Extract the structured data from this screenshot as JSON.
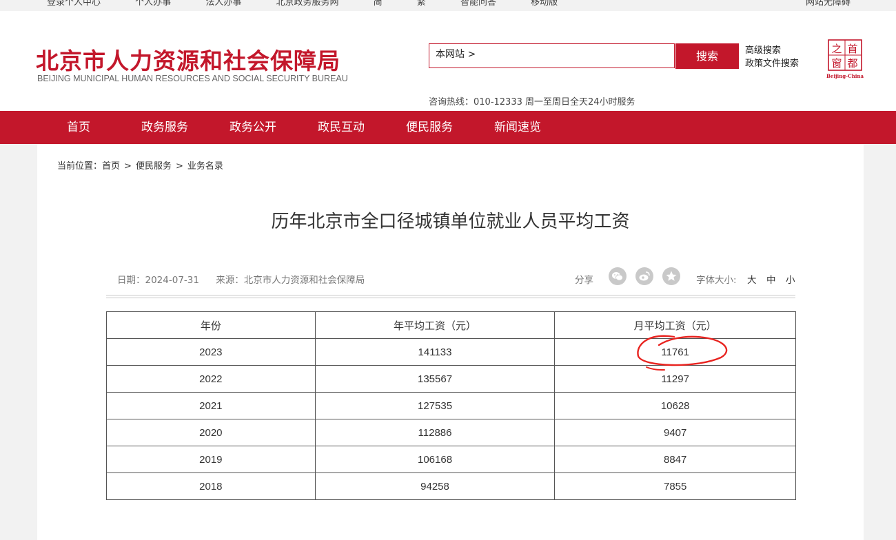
{
  "topbar": {
    "links": [
      "登录个人中心",
      "个人办事",
      "法人办事",
      "北京政务服务网",
      "简",
      "繁",
      "智能问答",
      "移动版"
    ],
    "right": "网站无障碍"
  },
  "header": {
    "logo_cn": "北京市人力资源和社会保障局",
    "logo_en": "BEIJING MUNICIPAL HUMAN RESOURCES AND SOCIAL SECURITY BUREAU",
    "search_scope": "本网站 >",
    "search_button": "搜索",
    "advanced_search": "高级搜索",
    "policy_search": "政策文件搜索",
    "hotline": "咨询热线：010-12333 周一至周日全天24小时服务",
    "badge": {
      "chars": [
        "首",
        "都",
        "之",
        "窗"
      ],
      "caption": "Beijing-China"
    }
  },
  "nav": [
    "首页",
    "政务服务",
    "政务公开",
    "政民互动",
    "便民服务",
    "新闻速览"
  ],
  "breadcrumb": {
    "prefix": "当前位置：",
    "items": [
      "首页",
      "便民服务",
      "业务名录"
    ],
    "sep": ">"
  },
  "article": {
    "title": "历年北京市全口径城镇单位就业人员平均工资",
    "date": "日期：2024-07-31",
    "source": "来源：北京市人力资源和社会保障局",
    "share_label": "分享",
    "font_label": "字体大小:",
    "font_options": [
      "大",
      "中",
      "小"
    ]
  },
  "table": {
    "headers": [
      "年份",
      "年平均工资（元）",
      "月平均工资（元）"
    ],
    "rows": [
      [
        "2023",
        "141133",
        "11761"
      ],
      [
        "2022",
        "135567",
        "11297"
      ],
      [
        "2021",
        "127535",
        "10628"
      ],
      [
        "2020",
        "112886",
        "9407"
      ],
      [
        "2019",
        "106168",
        "8847"
      ],
      [
        "2018",
        "94258",
        "7855"
      ]
    ]
  },
  "colors": {
    "brand": "#c3172b",
    "annotation": "#e8231f"
  }
}
